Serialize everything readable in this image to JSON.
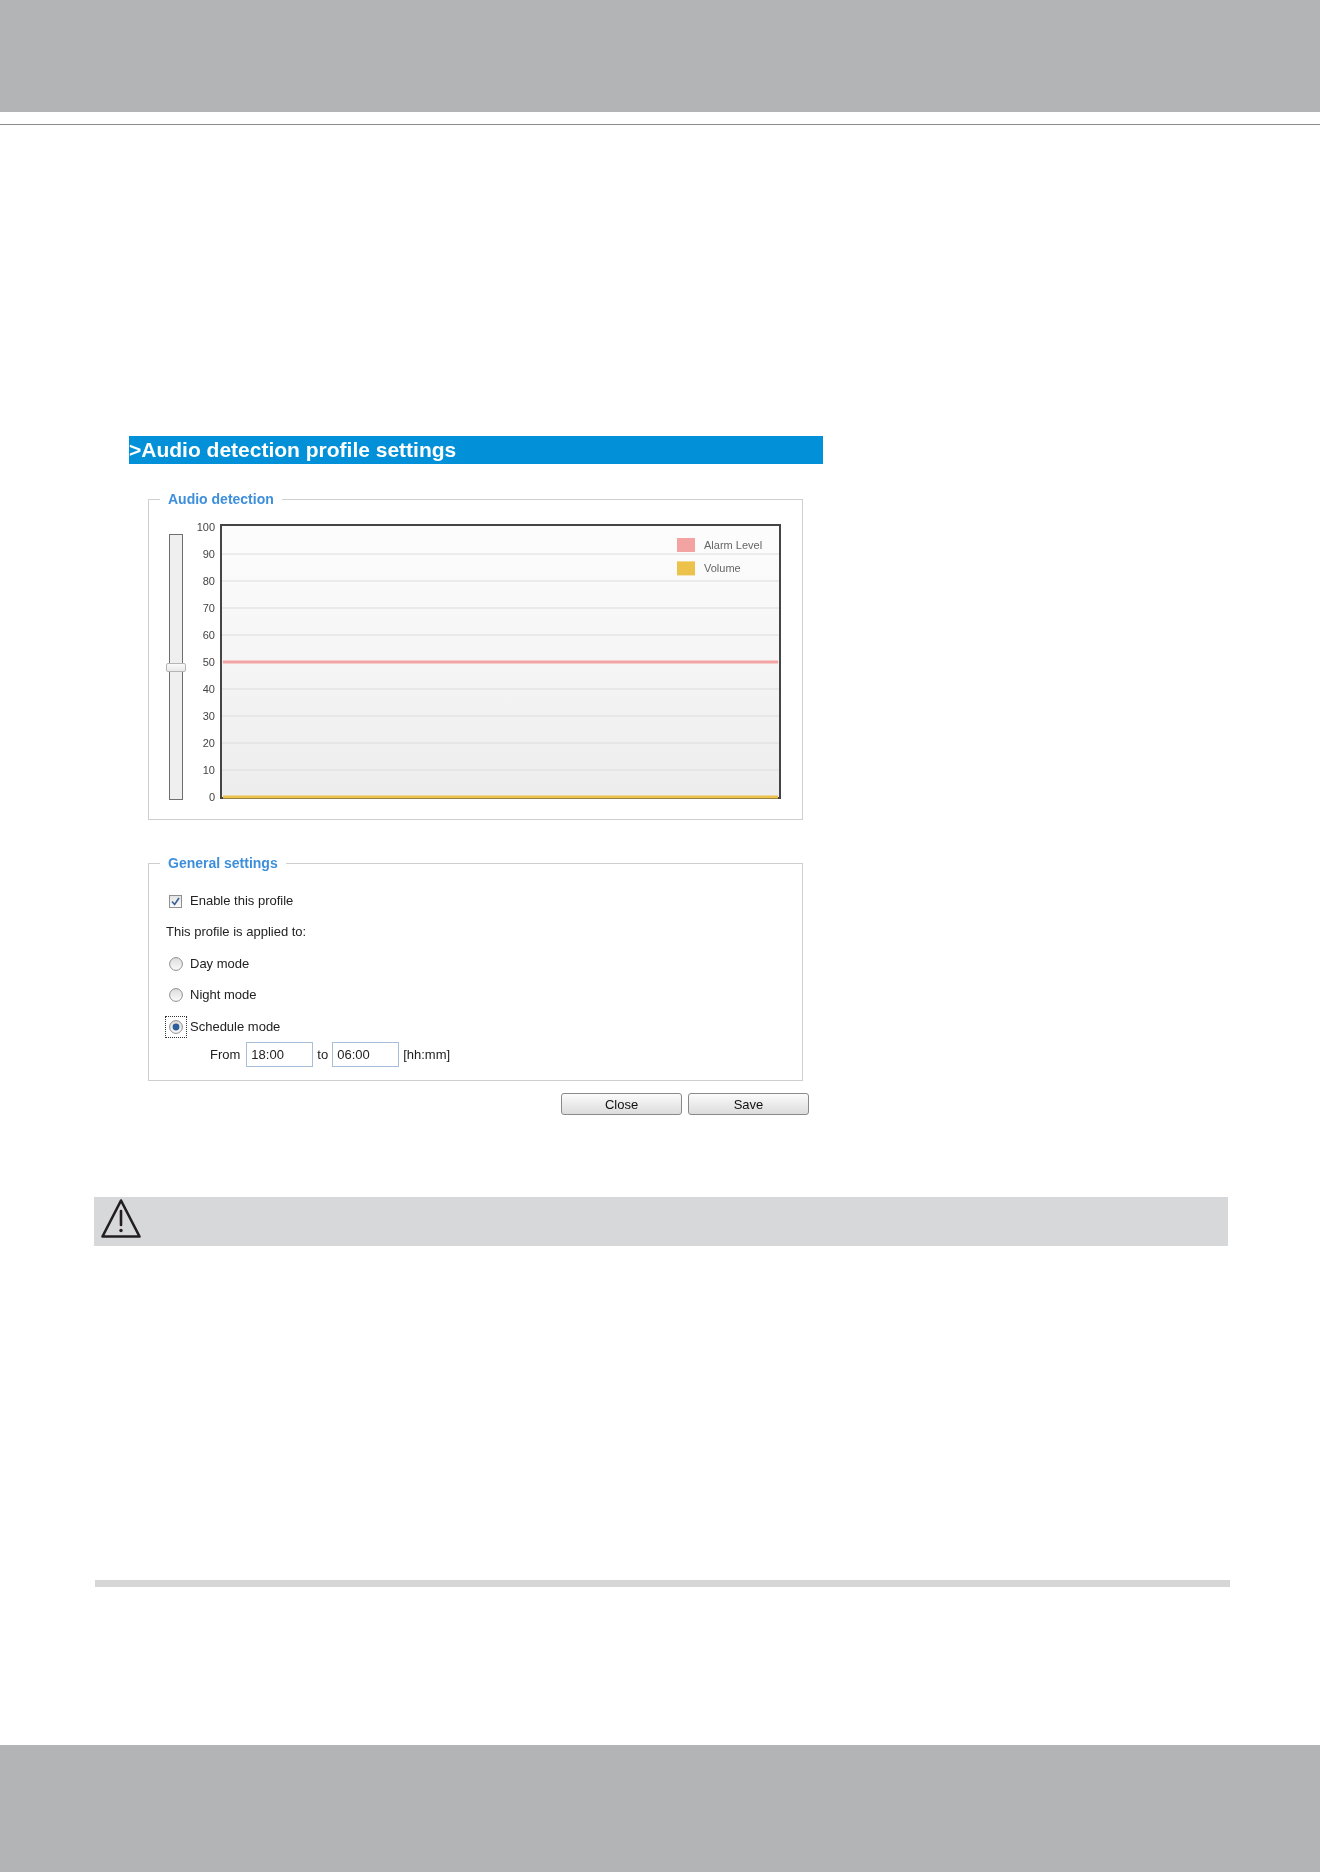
{
  "title": ">Audio detection profile settings",
  "audio_detection": {
    "legend": "Audio detection",
    "slider": {
      "level": 0.5
    },
    "chart_data": {
      "type": "line",
      "grid": true,
      "legend": true,
      "ylim": [
        0,
        100
      ],
      "yticks": [
        0,
        10,
        20,
        30,
        40,
        50,
        60,
        70,
        80,
        90,
        100
      ],
      "series": [
        {
          "name": "Alarm Level",
          "color": "#f4a3a3",
          "values": [
            50,
            50,
            50,
            50,
            50,
            50,
            50,
            50,
            50,
            50,
            50
          ]
        },
        {
          "name": "Volume",
          "color": "#ecc24a",
          "values": [
            0,
            0,
            0,
            0,
            0,
            0,
            0,
            0,
            0,
            0,
            0
          ]
        }
      ]
    }
  },
  "general_settings": {
    "legend": "General settings",
    "enable_profile": {
      "label": "Enable this profile",
      "checked": true
    },
    "applied_to": "This profile is applied to:",
    "modes": [
      {
        "label": "Day mode",
        "selected": false,
        "focused": false
      },
      {
        "label": "Night mode",
        "selected": false,
        "focused": false
      },
      {
        "label": "Schedule mode",
        "selected": true,
        "focused": true
      }
    ],
    "schedule": {
      "from_label": "From",
      "from": "18:00",
      "to_label": "to",
      "to": "06:00",
      "unit": "[hh:mm]"
    }
  },
  "buttons": [
    {
      "label": "Close"
    },
    {
      "label": "Save"
    }
  ]
}
